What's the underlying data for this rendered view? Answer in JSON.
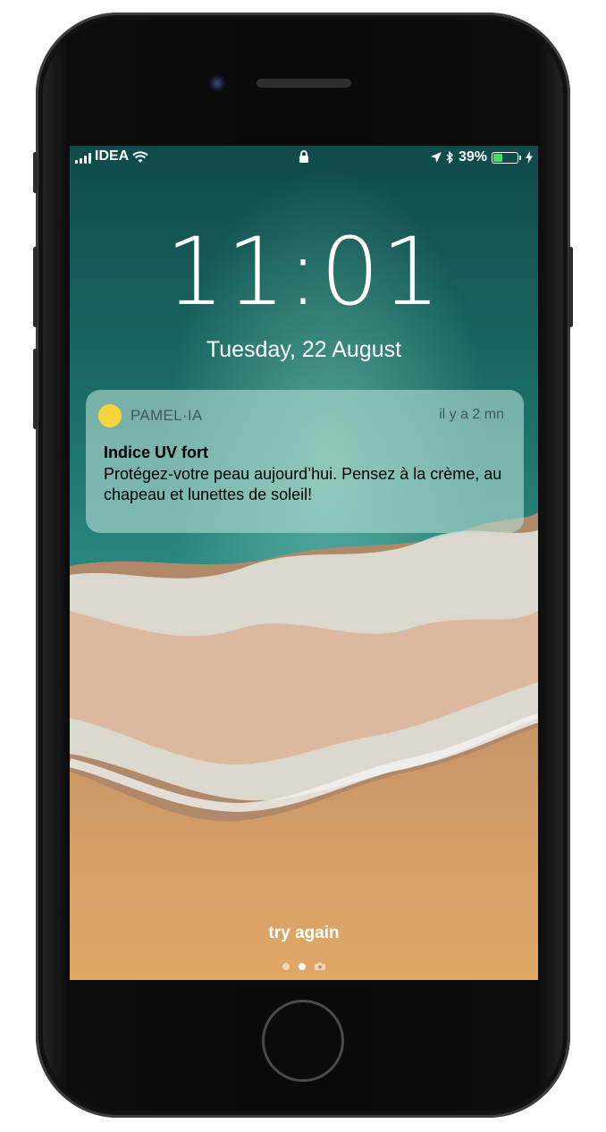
{
  "status_bar": {
    "carrier": "IDEA",
    "battery": "39%",
    "battery_level": 0.39,
    "icons": [
      "signal-icon",
      "wifi-icon",
      "lock-icon",
      "location-icon",
      "bluetooth-icon",
      "battery-icon",
      "charging-icon"
    ]
  },
  "lock_screen": {
    "time": "11:01",
    "date": "Tuesday, 22 August",
    "footer_text": "try again"
  },
  "notification": {
    "app_name": "PAMEL·IA",
    "time_ago": "il y a 2 mn",
    "title": "Indice UV fort",
    "body": "Protégez-votre peau aujourd’hui. Pensez à la crème, au chapeau et lunettes de soleil!",
    "icon_color": "#f5d63a"
  },
  "page_indicator": {
    "count": 2,
    "active": 1,
    "extra_icon": "camera-icon"
  }
}
